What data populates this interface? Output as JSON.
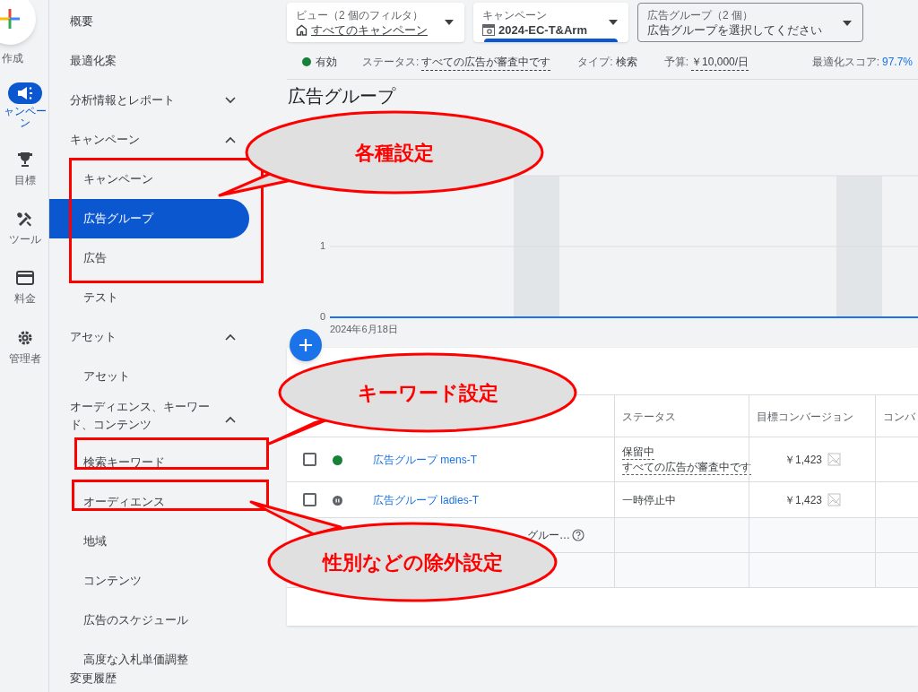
{
  "rail": {
    "create_label": "作成",
    "items": [
      {
        "kind": "megaphone",
        "label": "ャンペーン",
        "selected": true
      },
      {
        "kind": "trophy",
        "label": "目標",
        "selected": false
      },
      {
        "kind": "tools",
        "label": "ツール",
        "selected": false
      },
      {
        "kind": "card",
        "label": "料金",
        "selected": false
      },
      {
        "kind": "gear",
        "label": "管理者",
        "selected": false
      }
    ]
  },
  "nav": {
    "items": [
      {
        "label": "概要",
        "selected": false
      },
      {
        "label": "最適化案",
        "selected": false
      },
      {
        "label": "分析情報とレポート",
        "expanded": false,
        "selected": false
      },
      {
        "label": "キャンペーン",
        "expanded": true,
        "selected": false,
        "children": [
          {
            "label": "キャンペーン",
            "selected": false
          },
          {
            "label": "広告グループ",
            "selected": true
          },
          {
            "label": "広告",
            "selected": false
          },
          {
            "label": "テスト",
            "selected": false
          }
        ]
      },
      {
        "label": "アセット",
        "expanded": true,
        "selected": false,
        "children": [
          {
            "label": "アセット",
            "selected": false
          }
        ]
      },
      {
        "label": "オーディエンス、キーワード、コンテンツ",
        "expanded": true,
        "selected": false,
        "children": [
          {
            "label": "検索キーワード",
            "selected": false
          },
          {
            "label": "オーディエンス",
            "selected": false
          },
          {
            "label": "地域",
            "selected": false
          },
          {
            "label": "コンテンツ",
            "selected": false
          },
          {
            "label": "広告のスケジュール",
            "selected": false
          },
          {
            "label": "高度な入札単価調整",
            "selected": false
          }
        ]
      },
      {
        "label": "変更履歴",
        "selected": false
      }
    ]
  },
  "filters": [
    {
      "label": "ビュー（2 個のフィルタ）",
      "value": "すべてのキャンペーン",
      "underlined": true,
      "active": false
    },
    {
      "label": "キャンペーン",
      "value": "2024-EC-T&Arm",
      "underlined": false,
      "active": true
    },
    {
      "label": "広告グループ（2 個）",
      "value": "広告グループを選択してください",
      "underlined": false,
      "active": false
    }
  ],
  "summary": {
    "status": "有効",
    "status_label": "ステータス:",
    "status_value": "すべての広告が審査中です",
    "type_label": "タイプ:",
    "type_value": "検索",
    "budget_label": "予算:",
    "budget_value": "￥10,000/日",
    "score_label": "最適化スコア:",
    "score_value": "97.7%"
  },
  "page_title": "広告グループ",
  "chart": {
    "y_ticks": [
      "1",
      "0"
    ],
    "date_label": "2024年6月18日"
  },
  "table": {
    "columns": [
      "ステータス",
      "目標コンバージョン",
      "コンバ"
    ],
    "rows": [
      {
        "checked": false,
        "kind": "enabled",
        "name": "広告グループ mens-T",
        "status": "保留中",
        "status_detail": "すべての広告が審査中です",
        "target": "￥1,423"
      },
      {
        "checked": false,
        "kind": "paused",
        "name": "広告グループ ladies-T",
        "status": "一時停止中",
        "target": "￥1,423"
      }
    ],
    "total_row": "グルー…"
  },
  "callouts": [
    {
      "text": "各種設定",
      "kind": "top"
    },
    {
      "text": "キーワード設定",
      "kind": "middle"
    },
    {
      "text": "性別などの除外設定",
      "kind": "bottom"
    }
  ]
}
